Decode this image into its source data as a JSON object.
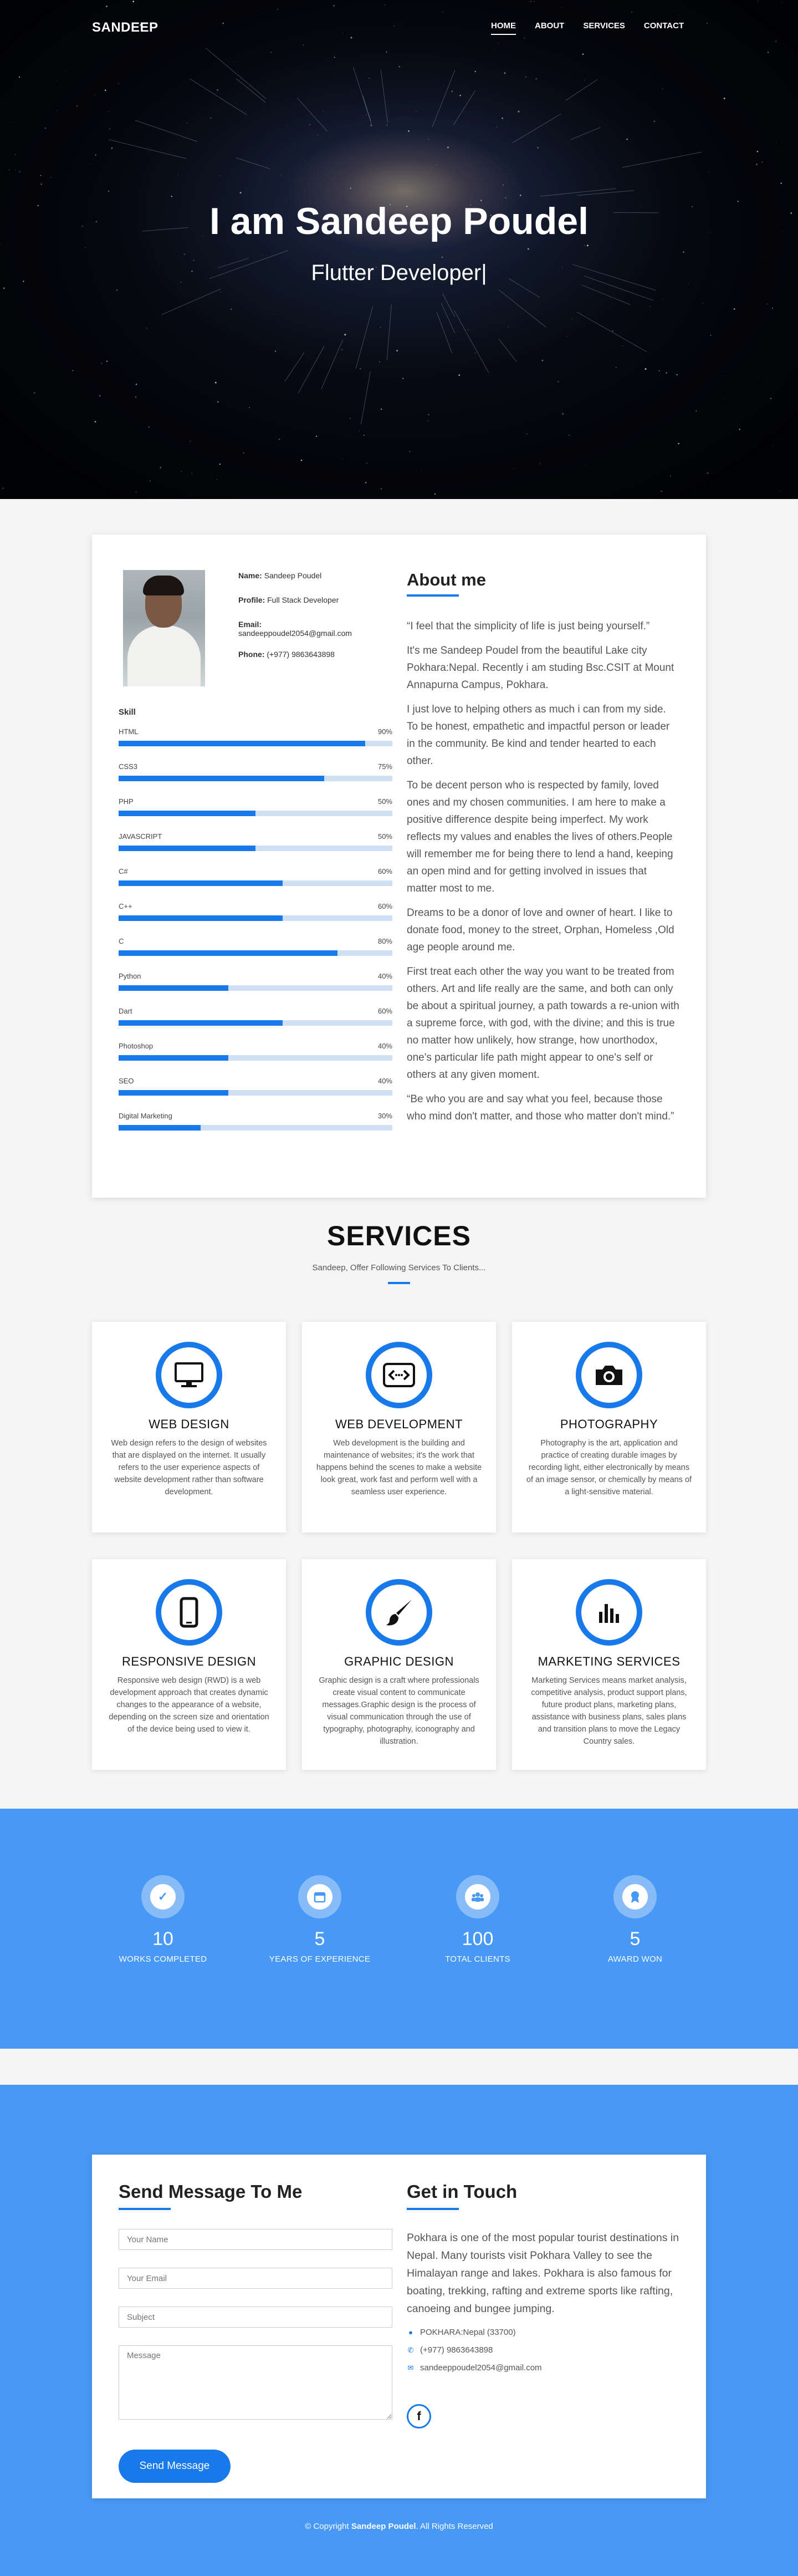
{
  "header": {
    "brand": "SANDEEP",
    "nav": [
      "HOME",
      "ABOUT",
      "SERVICES",
      "CONTACT"
    ],
    "active_nav": "HOME"
  },
  "hero": {
    "title": "I am Sandeep Poudel",
    "subtitle": "Flutter Developer|"
  },
  "profile": {
    "name_label": "Name:",
    "name": "Sandeep Poudel",
    "profile_label": "Profile:",
    "profile": "Full Stack Developer",
    "email_label": "Email:",
    "email": "sandeeppoudel2054@gmail.com",
    "phone_label": "Phone:",
    "phone": "(+977) 9863643898"
  },
  "skills": {
    "heading": "Skill",
    "items": [
      {
        "name": "HTML",
        "percent": "90%"
      },
      {
        "name": "CSS3",
        "percent": "75%"
      },
      {
        "name": "PHP",
        "percent": "50%"
      },
      {
        "name": "JAVASCRIPT",
        "percent": "50%"
      },
      {
        "name": "C#",
        "percent": "60%"
      },
      {
        "name": "C++",
        "percent": "60%"
      },
      {
        "name": "C",
        "percent": "80%"
      },
      {
        "name": "Python",
        "percent": "40%"
      },
      {
        "name": "Dart",
        "percent": "60%"
      },
      {
        "name": "Photoshop",
        "percent": "40%"
      },
      {
        "name": "SEO",
        "percent": "40%"
      },
      {
        "name": "Digital Marketing",
        "percent": "30%"
      }
    ]
  },
  "about": {
    "heading": "About me",
    "paragraphs": [
      "“I feel that the simplicity of life is just being yourself.”",
      "It's me Sandeep Poudel from the beautiful Lake city Pokhara:Nepal. Recently i am studing Bsc.CSIT at Mount Annapurna Campus, Pokhara.",
      "I just love to helping others as much i can from my side. To be honest, empathetic and impactful person or leader in the community. Be kind and tender hearted to each other.",
      "To be decent person who is respected by family, loved ones and my chosen communities. I am here to make a positive difference despite being imperfect. My work reflects my values and enables the lives of others.People will remember me for being there to lend a hand, keeping an open mind and for getting involved in issues that matter most to me.",
      "Dreams to be a donor of love and owner of heart. I like to donate food, money to the street, Orphan, Homeless ,Old age people around me.",
      "First treat each other the way you want to be treated from others. Art and life really are the same, and both can only be about a spiritual journey, a path towards a re-union with a supreme force, with god, with the divine; and this is true no matter how unlikely, how strange, how unorthodox, one's particular life path might appear to one's self or others at any given moment.",
      "“Be who you are and say what you feel, because those who mind don't matter, and those who matter don't mind.”"
    ]
  },
  "services": {
    "title": "SERVICES",
    "subtitle": "Sandeep, Offer Following Services To Clients...",
    "items": [
      {
        "icon": "monitor-icon",
        "title": "WEB DESIGN",
        "text": "Web design refers to the design of websites that are displayed on the internet. It usually refers to the user experience aspects of website development rather than software development."
      },
      {
        "icon": "code-icon",
        "title": "WEB DEVELOPMENT",
        "text": "Web development is the building and maintenance of websites; it's the work that happens behind the scenes to make a website look great, work fast and perform well with a seamless user experience."
      },
      {
        "icon": "camera-icon",
        "title": "PHOTOGRAPHY",
        "text": "Photography is the art, application and practice of creating durable images by recording light, either electronically by means of an image sensor, or chemically by means of a light-sensitive material."
      },
      {
        "icon": "phone-icon",
        "title": "RESPONSIVE DESIGN",
        "text": "Responsive web design (RWD) is a web development approach that creates dynamic changes to the appearance of a website, depending on the screen size and orientation of the device being used to view it."
      },
      {
        "icon": "brush-icon",
        "title": "GRAPHIC DESIGN",
        "text": "Graphic design is a craft where professionals create visual content to communicate messages.Graphic design is the process of visual communication through the use of typography, photography, iconography and illustration."
      },
      {
        "icon": "bar-chart-icon",
        "title": "MARKETING SERVICES",
        "text": "Marketing Services means market analysis, competitive analysis, product support plans, future product plans, marketing plans, assistance with business plans, sales plans and transition plans to move the Legacy Country sales."
      }
    ]
  },
  "stats": [
    {
      "icon": "check-icon",
      "value": "10",
      "label": "WORKS COMPLETED"
    },
    {
      "icon": "calendar-icon",
      "value": "5",
      "label": "YEARS OF EXPERIENCE"
    },
    {
      "icon": "users-icon",
      "value": "100",
      "label": "TOTAL CLIENTS"
    },
    {
      "icon": "award-icon",
      "value": "5",
      "label": "AWARD WON"
    }
  ],
  "contact": {
    "form_heading": "Send Message To Me",
    "name_placeholder": "Your Name",
    "email_placeholder": "Your Email",
    "subject_placeholder": "Subject",
    "message_placeholder": "Message",
    "send_label": "Send Message",
    "touch_heading": "Get in Touch",
    "touch_text": "Pokhara is one of the most popular tourist destinations in Nepal. Many tourists visit Pokhara Valley to see the Himalayan range and lakes. Pokhara is also famous for boating, trekking, rafting and extreme sports like rafting, canoeing and bungee jumping.",
    "address": "POKHARA:Nepal (33700)",
    "phone": "(+977) 9863643898",
    "email": "sandeeppoudel2054@gmail.com",
    "social": "f"
  },
  "footer": {
    "prefix": "© Copyright",
    "name": "Sandeep Poudel",
    "suffix": ". All Rights Reserved"
  },
  "colors": {
    "accent": "#1779ea",
    "stats_bg": "#4899f5",
    "progress_track": "#cfe0f5"
  }
}
